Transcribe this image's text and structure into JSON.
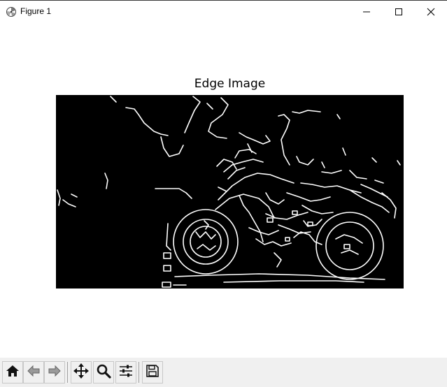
{
  "window": {
    "title": "Figure 1",
    "icons": {
      "app": "matplotlib-figure-icon",
      "minimize": "minimize-icon",
      "maximize": "maximize-icon",
      "close": "close-icon"
    }
  },
  "figure": {
    "title": "Edge Image",
    "image_description_colors": {
      "background": "#000000",
      "edges": "#ffffff"
    }
  },
  "toolbar": {
    "buttons": [
      {
        "name": "home",
        "icon": "home-icon"
      },
      {
        "name": "back",
        "icon": "back-arrow-icon"
      },
      {
        "name": "forward",
        "icon": "forward-arrow-icon"
      },
      {
        "name": "pan",
        "icon": "move-icon"
      },
      {
        "name": "zoom",
        "icon": "zoom-icon"
      },
      {
        "name": "configure-subplots",
        "icon": "sliders-icon"
      },
      {
        "name": "save",
        "icon": "save-icon"
      }
    ]
  }
}
